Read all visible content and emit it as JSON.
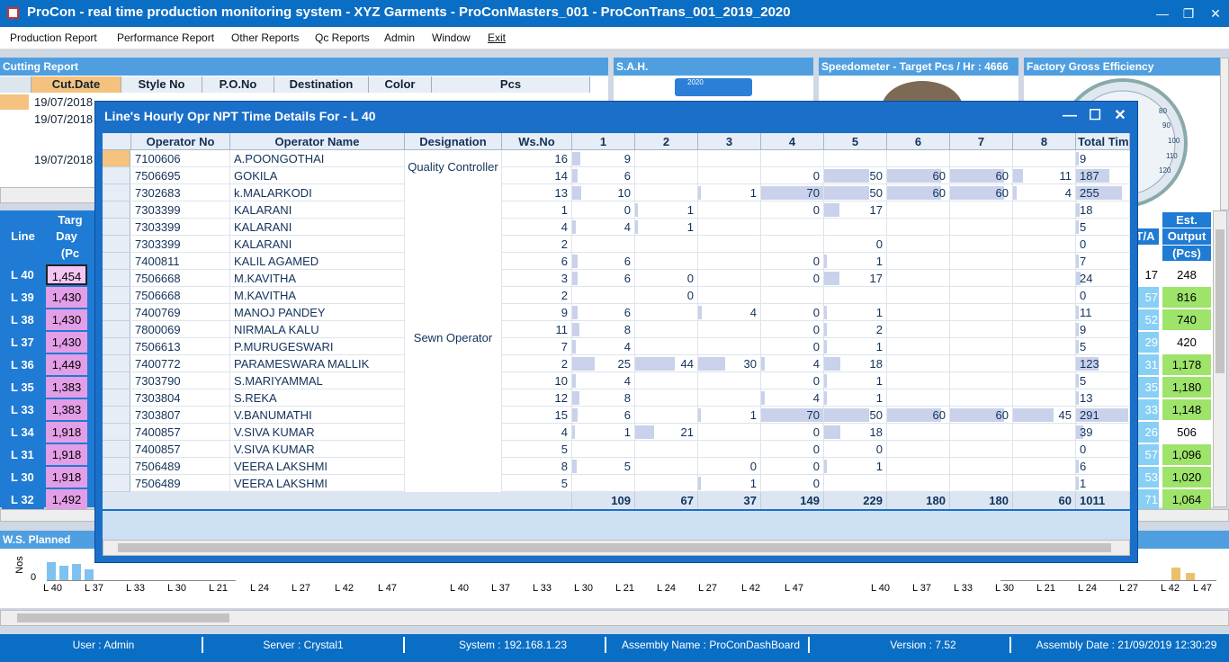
{
  "window": {
    "title": "ProCon - real time production monitoring system - XYZ Garments - ProConMasters_001 - ProConTrans_001_2019_2020",
    "min": "—",
    "max": "❐",
    "close": "✕"
  },
  "menu": [
    "Production Report",
    "Performance Report",
    "Other Reports",
    "Qc Reports",
    "Admin",
    "Window",
    "Exit"
  ],
  "panels": {
    "cutting": "Cutting Report",
    "sah": "S.A.H.",
    "speedometer": "Speedometer - Target Pcs / Hr : 4666",
    "factory": "Factory Gross Efficiency",
    "ws_planned": "W.S. Planned"
  },
  "cutting": {
    "headers": [
      "Cut.Date",
      "Style No",
      "P.O.No",
      "Destination",
      "Color",
      "Pcs"
    ],
    "dates": [
      "19/07/2018",
      "19/07/2018",
      "19/07/2018"
    ]
  },
  "line_table": {
    "h_line": "Line",
    "h_target": "Targ",
    "h_day": "Day",
    "h_pcs": "(Pc",
    "h_ta": "T/A",
    "h_est": "Est.",
    "h_output": "Output",
    "h_opcs": "(Pcs)",
    "rows": [
      {
        "line": "L 40",
        "day": "1,454",
        "ta": "17",
        "out": "248"
      },
      {
        "line": "L 39",
        "day": "1,430",
        "ta": "57",
        "out": "816"
      },
      {
        "line": "L 38",
        "day": "1,430",
        "ta": "52",
        "out": "740"
      },
      {
        "line": "L 37",
        "day": "1,430",
        "ta": "29",
        "out": "420"
      },
      {
        "line": "L 36",
        "day": "1,449",
        "ta": "31",
        "out": "1,178"
      },
      {
        "line": "L 35",
        "day": "1,383",
        "ta": "35",
        "out": "1,180"
      },
      {
        "line": "L 33",
        "day": "1,383",
        "ta": "33",
        "out": "1,148"
      },
      {
        "line": "L 34",
        "day": "1,918",
        "ta": "26",
        "out": "506"
      },
      {
        "line": "L 31",
        "day": "1,918",
        "ta": "57",
        "out": "1,096"
      },
      {
        "line": "L 30",
        "day": "1,918",
        "ta": "53",
        "out": "1,020"
      },
      {
        "line": "L 32",
        "day": "1,492",
        "ta": "71",
        "out": "1,064"
      }
    ]
  },
  "ws_planned": {
    "ylabel": "Nos",
    "zero": "0",
    "axis1": [
      "L 40",
      "L 37",
      "L 33",
      "L 30",
      "L 21",
      "L 24",
      "L 27",
      "L 42",
      "L 47"
    ],
    "axis2": [
      "L 40",
      "L 37",
      "L 33",
      "L 30",
      "L 21",
      "L 24",
      "L 27",
      "L 42",
      "L 47"
    ],
    "axis3": [
      "L 40",
      "L 37",
      "L 33",
      "L 30",
      "L 21",
      "L 24",
      "L 27",
      "L 42",
      "L 47"
    ]
  },
  "sah_label": "2020",
  "gauge_labels": [
    "80",
    "90",
    "100",
    "110",
    "120"
  ],
  "dialog": {
    "title": "Line's Hourly Opr NPT Time Details For - L 40",
    "min": "—",
    "max": "☐",
    "close": "✕",
    "headers": [
      "Operator No",
      "Operator Name",
      "Designation",
      "Ws.No",
      "1",
      "2",
      "3",
      "4",
      "5",
      "6",
      "7",
      "8",
      "Total Time"
    ],
    "designations": [
      "Quality Controller",
      "Sewn Operator"
    ],
    "rows": [
      {
        "no": "7100606",
        "name": "A.POONGOTHAI",
        "ws": "16",
        "h": [
          "9",
          "",
          "",
          "",
          "",
          "",
          "",
          ""
        ],
        "total": "9"
      },
      {
        "no": "7506695",
        "name": "GOKILA",
        "ws": "14",
        "h": [
          "6",
          "",
          "",
          "0",
          "50",
          "60",
          "60",
          "11"
        ],
        "total": "187"
      },
      {
        "no": "7302683",
        "name": "k.MALARKODI",
        "ws": "13",
        "h": [
          "10",
          "",
          "1",
          "70",
          "50",
          "60",
          "60",
          "4"
        ],
        "total": "255"
      },
      {
        "no": "7303399",
        "name": "KALARANI",
        "ws": "1",
        "h": [
          "0",
          "1",
          "",
          "0",
          "17",
          "",
          "",
          ""
        ],
        "total": "18"
      },
      {
        "no": "7303399",
        "name": "KALARANI",
        "ws": "4",
        "h": [
          "4",
          "1",
          "",
          "",
          "",
          "",
          "",
          ""
        ],
        "total": "5"
      },
      {
        "no": "7303399",
        "name": "KALARANI",
        "ws": "2",
        "h": [
          "",
          "",
          "",
          "",
          "0",
          "",
          "",
          ""
        ],
        "total": "0"
      },
      {
        "no": "7400811",
        "name": "KALIL AGAMED",
        "ws": "6",
        "h": [
          "6",
          "",
          "",
          "0",
          "1",
          "",
          "",
          ""
        ],
        "total": "7"
      },
      {
        "no": "7506668",
        "name": "M.KAVITHA",
        "ws": "3",
        "h": [
          "6",
          "0",
          "",
          "0",
          "17",
          "",
          "",
          ""
        ],
        "total": "24"
      },
      {
        "no": "7506668",
        "name": "M.KAVITHA",
        "ws": "2",
        "h": [
          "",
          "0",
          "",
          "",
          "",
          "",
          "",
          ""
        ],
        "total": "0"
      },
      {
        "no": "7400769",
        "name": "MANOJ PANDEY",
        "ws": "9",
        "h": [
          "6",
          "",
          "4",
          "0",
          "1",
          "",
          "",
          ""
        ],
        "total": "11"
      },
      {
        "no": "7800069",
        "name": "NIRMALA KALU",
        "ws": "11",
        "h": [
          "8",
          "",
          "",
          "0",
          "2",
          "",
          "",
          ""
        ],
        "total": "9"
      },
      {
        "no": "7506613",
        "name": "P.MURUGESWARI",
        "ws": "7",
        "h": [
          "4",
          "",
          "",
          "0",
          "1",
          "",
          "",
          ""
        ],
        "total": "5"
      },
      {
        "no": "7400772",
        "name": "PARAMESWARA MALLIK",
        "ws": "2",
        "h": [
          "25",
          "44",
          "30",
          "4",
          "18",
          "",
          "",
          ""
        ],
        "total": "123"
      },
      {
        "no": "7303790",
        "name": "S.MARIYAMMAL",
        "ws": "10",
        "h": [
          "4",
          "",
          "",
          "0",
          "1",
          "",
          "",
          ""
        ],
        "total": "5"
      },
      {
        "no": "7303804",
        "name": "S.REKA",
        "ws": "12",
        "h": [
          "8",
          "",
          "",
          "4",
          "1",
          "",
          "",
          ""
        ],
        "total": "13"
      },
      {
        "no": "7303807",
        "name": "V.BANUMATHI",
        "ws": "15",
        "h": [
          "6",
          "",
          "1",
          "70",
          "50",
          "60",
          "60",
          "45"
        ],
        "total": "291"
      },
      {
        "no": "7400857",
        "name": "V.SIVA KUMAR",
        "ws": "4",
        "h": [
          "1",
          "21",
          "",
          "0",
          "18",
          "",
          "",
          ""
        ],
        "total": "39"
      },
      {
        "no": "7400857",
        "name": "V.SIVA KUMAR",
        "ws": "5",
        "h": [
          "",
          "",
          "",
          "0",
          "0",
          "",
          "",
          ""
        ],
        "total": "0"
      },
      {
        "no": "7506489",
        "name": "VEERA LAKSHMI",
        "ws": "8",
        "h": [
          "5",
          "",
          "0",
          "0",
          "1",
          "",
          "",
          ""
        ],
        "total": "6"
      },
      {
        "no": "7506489",
        "name": "VEERA LAKSHMI",
        "ws": "5",
        "h": [
          "",
          "",
          "1",
          "0",
          "",
          "",
          "",
          ""
        ],
        "total": "1"
      }
    ],
    "totals": [
      "109",
      "67",
      "37",
      "149",
      "229",
      "180",
      "180",
      "60",
      "1011"
    ]
  },
  "status": {
    "user": "User : Admin",
    "server": "Server : Crystal1",
    "system": "System : 192.168.1.23",
    "assembly": "Assembly Name : ProConDashBoard",
    "version": "Version : 7.52",
    "date": "Assembly Date : 21/09/2019 12:30:29"
  }
}
